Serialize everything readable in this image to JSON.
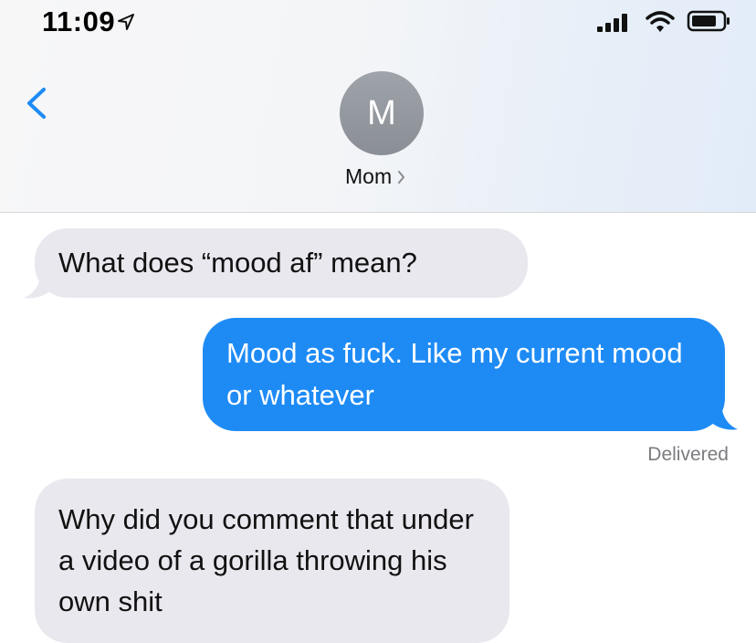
{
  "status_bar": {
    "time": "11:09",
    "icons": [
      "location-arrow-icon",
      "signal-bars-icon",
      "wifi-icon",
      "battery-icon"
    ]
  },
  "header": {
    "back_icon": "chevron-left-icon",
    "avatar_initial": "M",
    "contact_name": "Mom",
    "accent_color": "#1e8bf5"
  },
  "messages": [
    {
      "direction": "incoming",
      "text": "What does “mood af” mean?"
    },
    {
      "direction": "outgoing",
      "text": "Mood as fuck. Like my current mood or whatever"
    },
    {
      "direction": "incoming",
      "text": "Why did you comment that under a video of a gorilla throwing his own shit"
    }
  ],
  "delivery_status": "Delivered",
  "colors": {
    "outgoing_bubble": "#1e8bf5",
    "incoming_bubble": "#e8e8ee",
    "status_text": "#7c7c80"
  }
}
